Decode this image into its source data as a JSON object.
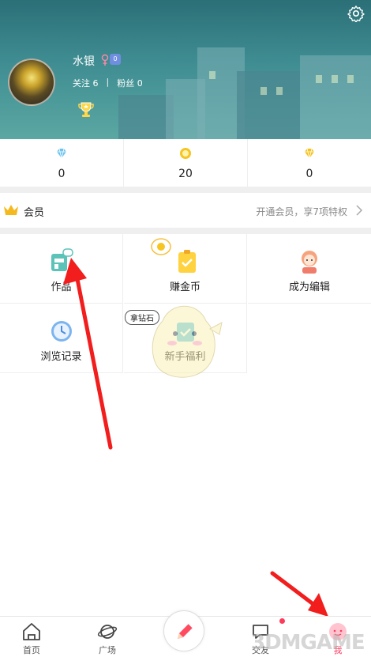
{
  "profile": {
    "username": "水银",
    "level": "0",
    "follow_label": "关注 6",
    "fans_label": "粉丝 0",
    "separator": "|"
  },
  "currency": [
    {
      "name": "diamond",
      "icon": "diamond-icon",
      "value": "0",
      "color": "#6cc3ee"
    },
    {
      "name": "coin",
      "icon": "coin-icon",
      "value": "20",
      "color": "#f6c522"
    },
    {
      "name": "gem",
      "icon": "gold-gem-icon",
      "value": "0",
      "color": "#f5c21b"
    }
  ],
  "vip": {
    "label": "会员",
    "promo": "开通会员，享7项特权"
  },
  "grid": [
    {
      "label": "作品",
      "icon": "works-icon"
    },
    {
      "label": "赚金币",
      "icon": "earn-coins-icon"
    },
    {
      "label": "成为编辑",
      "icon": "editor-icon"
    },
    {
      "label": "浏览记录",
      "icon": "history-clock-icon"
    },
    {
      "label": "新手福利",
      "icon": "newbie-gift-icon"
    }
  ],
  "mascot_bubble": "拿钻石",
  "nav": [
    {
      "label": "首页",
      "icon": "home-icon"
    },
    {
      "label": "广场",
      "icon": "planet-icon"
    },
    {
      "label": "交友",
      "icon": "chat-icon"
    },
    {
      "label": "我",
      "icon": "me-icon"
    }
  ],
  "watermark": "3DMGAME",
  "colors": {
    "accent": "#ff3b5c",
    "banner": "#3f8d92",
    "arrow": "#f21d1d"
  }
}
